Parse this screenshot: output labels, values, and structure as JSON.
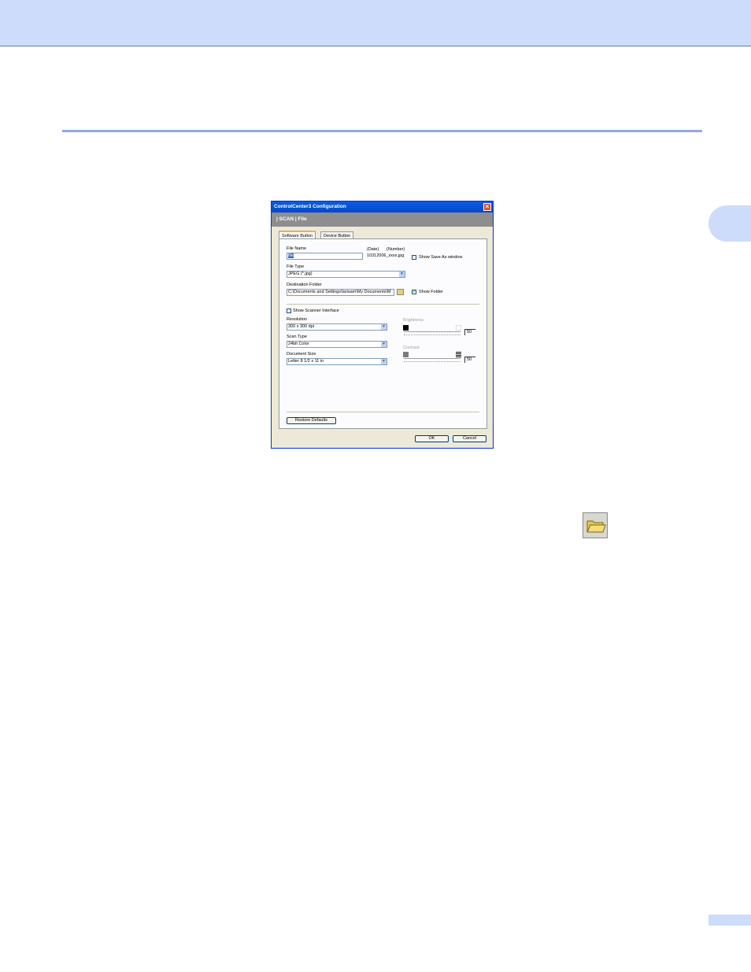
{
  "dialog": {
    "title": "ControlCenter3 Configuration",
    "close_symbol": "×",
    "breadcrumb": "|  SCAN  |   File",
    "tabs": [
      {
        "label": "Software Button",
        "active": true
      },
      {
        "label": "Device Button",
        "active": false
      }
    ],
    "file_name": {
      "label": "File Name",
      "value": "file",
      "date_header": "(Date)",
      "number_header": "(Number)",
      "example": "10312006_xxxx.jpg"
    },
    "show_save_as": {
      "label": "Show Save As window",
      "checked": false
    },
    "file_type": {
      "label": "File Type",
      "value": "JPEG (*.jpg)"
    },
    "destination_folder": {
      "label": "Destination Folder",
      "value": "C:\\Documents and Settings\\larisam\\My Documents\\M"
    },
    "show_folder": {
      "label": "Show Folder",
      "checked": true,
      "check_mark": "✔"
    },
    "show_scanner_interface": {
      "label": "Show Scanner Interface",
      "checked": false
    },
    "resolution": {
      "label": "Resolution",
      "value": "300 x 300 dpi"
    },
    "scan_type": {
      "label": "Scan Type",
      "value": "24bit Color"
    },
    "document_size": {
      "label": "Document Size",
      "value": "Letter 8 1/2 x 11 in"
    },
    "brightness": {
      "label": "Brightness",
      "value": "50"
    },
    "contrast": {
      "label": "Contrast",
      "value": "50"
    },
    "restore_defaults": "Restore Defaults",
    "ok": "OK",
    "cancel": "Cancel",
    "combo_arrow": "▼"
  },
  "icons": {
    "folder_button": "open-folder-icon"
  },
  "colors": {
    "header_band": "#cddcfb",
    "rule": "#8fa8e8",
    "titlebar": "#0a5be6"
  }
}
